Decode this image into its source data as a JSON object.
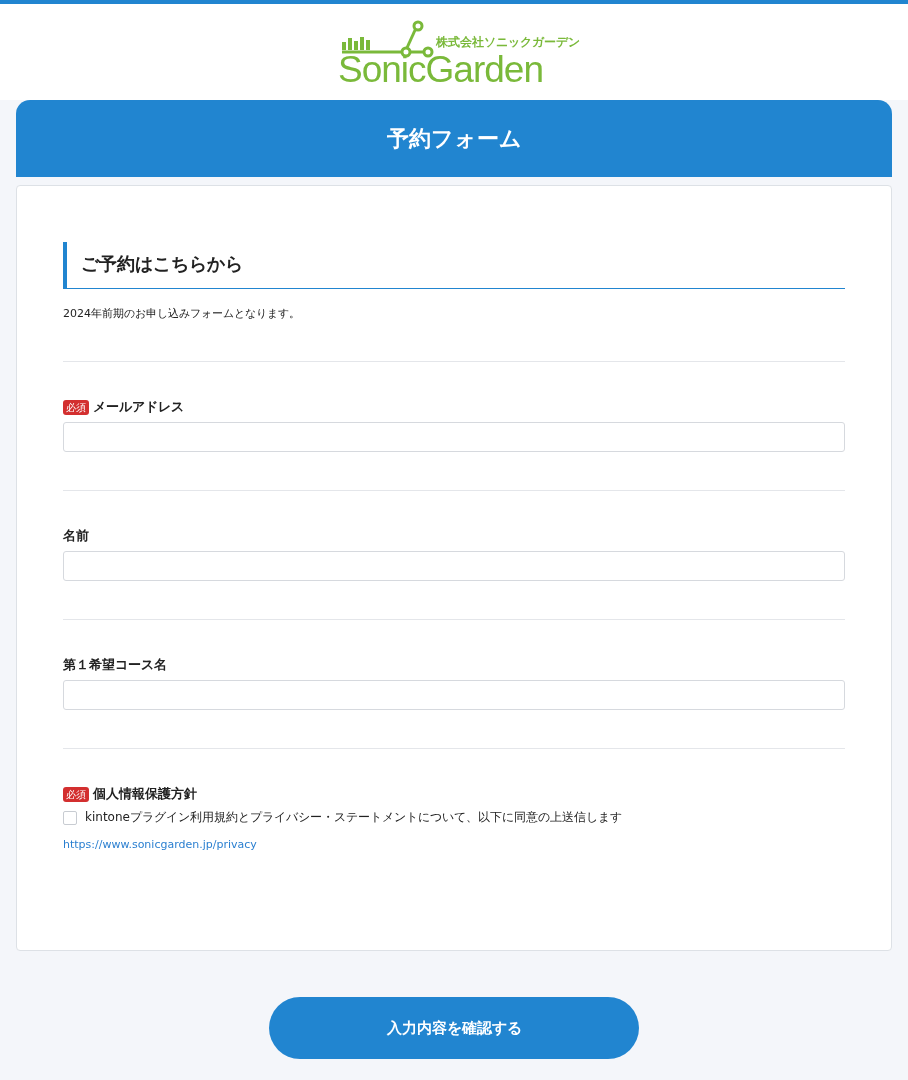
{
  "logo": {
    "company": "株式会社ソニックガーデン",
    "wordmark": "SonicGarden"
  },
  "form_title": "予約フォーム",
  "section": {
    "heading": "ご予約はこちらから",
    "description": "2024年前期のお申し込みフォームとなります。"
  },
  "fields": [
    {
      "kind": "text",
      "label": "メールアドレス",
      "required": true,
      "badge": "必須"
    },
    {
      "kind": "text",
      "label": "名前",
      "required": false
    },
    {
      "kind": "text",
      "label": "第１希望コース名",
      "required": false
    },
    {
      "kind": "checkbox",
      "label": "個人情報保護方針",
      "required": true,
      "badge": "必須",
      "option": "kintoneプラグイン利用規約とプライバシー・ステートメントについて、以下に同意の上送信します",
      "checked": false,
      "link": "https://www.sonicgarden.jp/privacy"
    }
  ],
  "submit": "入力内容を確認する"
}
